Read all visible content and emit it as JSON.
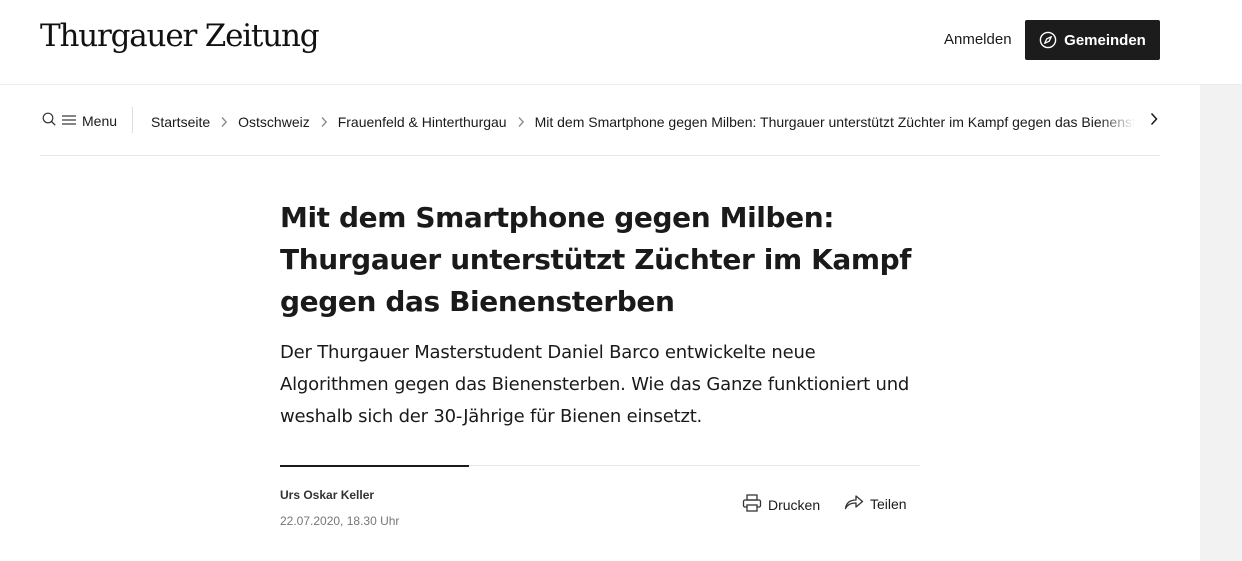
{
  "header": {
    "logo": "Thurgauer Zeitung",
    "login_label": "Anmelden",
    "communities_label": "Gemeinden"
  },
  "nav": {
    "menu_label": "Menu",
    "breadcrumbs": [
      {
        "label": "Startseite"
      },
      {
        "label": "Ostschweiz"
      },
      {
        "label": "Frauenfeld & Hinterthurgau"
      },
      {
        "label": "Mit dem Smartphone gegen Milben: Thurgauer unterstützt Züchter im Kampf gegen das Bienensterben"
      }
    ]
  },
  "article": {
    "title": "Mit dem Smartphone gegen Milben: Thurgauer unterstützt Züchter im Kampf gegen das Bienensterben",
    "lead": "Der Thurgauer Masterstudent Daniel Barco entwickelte neue Algorithmen gegen das Bienensterben. Wie das Ganze funktioniert und weshalb sich der 30-Jährige für Bienen einsetzt.",
    "author": "Urs Oskar Keller",
    "date": "22.07.2020, 18.30 Uhr",
    "print_label": "Drucken",
    "share_label": "Teilen"
  }
}
